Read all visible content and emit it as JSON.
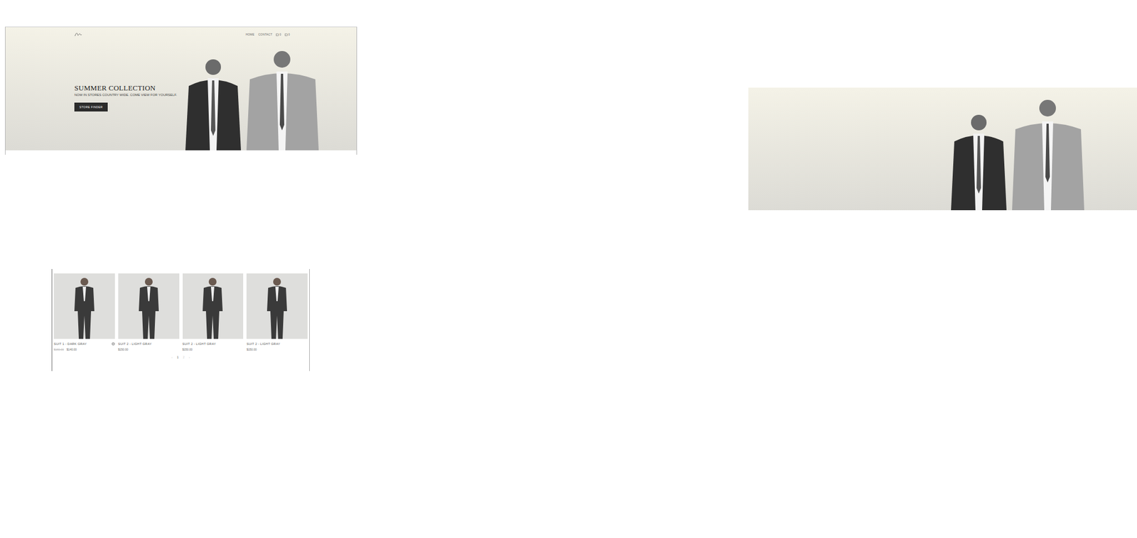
{
  "hero_mockup": {
    "nav": [
      {
        "label": "HOME"
      },
      {
        "label": "CONTACT"
      }
    ],
    "counters": [
      {
        "count": "0"
      },
      {
        "count": "0"
      }
    ],
    "title": "SUMMER COLLECTION",
    "subtitle": "NOW IN STORES COUNTRY WIDE. COME VIEW FOR YOURSELF.",
    "button": "STORE FINDER"
  },
  "banner_image": {
    "shown": true
  },
  "carousel": {
    "products": [
      {
        "name": "SUIT 1 - DARK GRAY",
        "old_price": "$160.00",
        "price": "$140.00",
        "compare_icon": true
      },
      {
        "name": "SUIT 2 - LIGHT GRAY",
        "old_price": "",
        "price": "$150.00",
        "compare_icon": false
      },
      {
        "name": "SUIT 2 - LIGHT GRAY",
        "old_price": "",
        "price": "$150.00",
        "compare_icon": false
      },
      {
        "name": "SUIT 2 - LIGHT GRAY",
        "old_price": "",
        "price": "$150.00",
        "compare_icon": false
      }
    ],
    "pages": [
      {
        "label": "‹",
        "selected": false
      },
      {
        "label": "1",
        "selected": true
      },
      {
        "label": "2",
        "selected": false
      },
      {
        "label": "›",
        "selected": false
      }
    ]
  }
}
